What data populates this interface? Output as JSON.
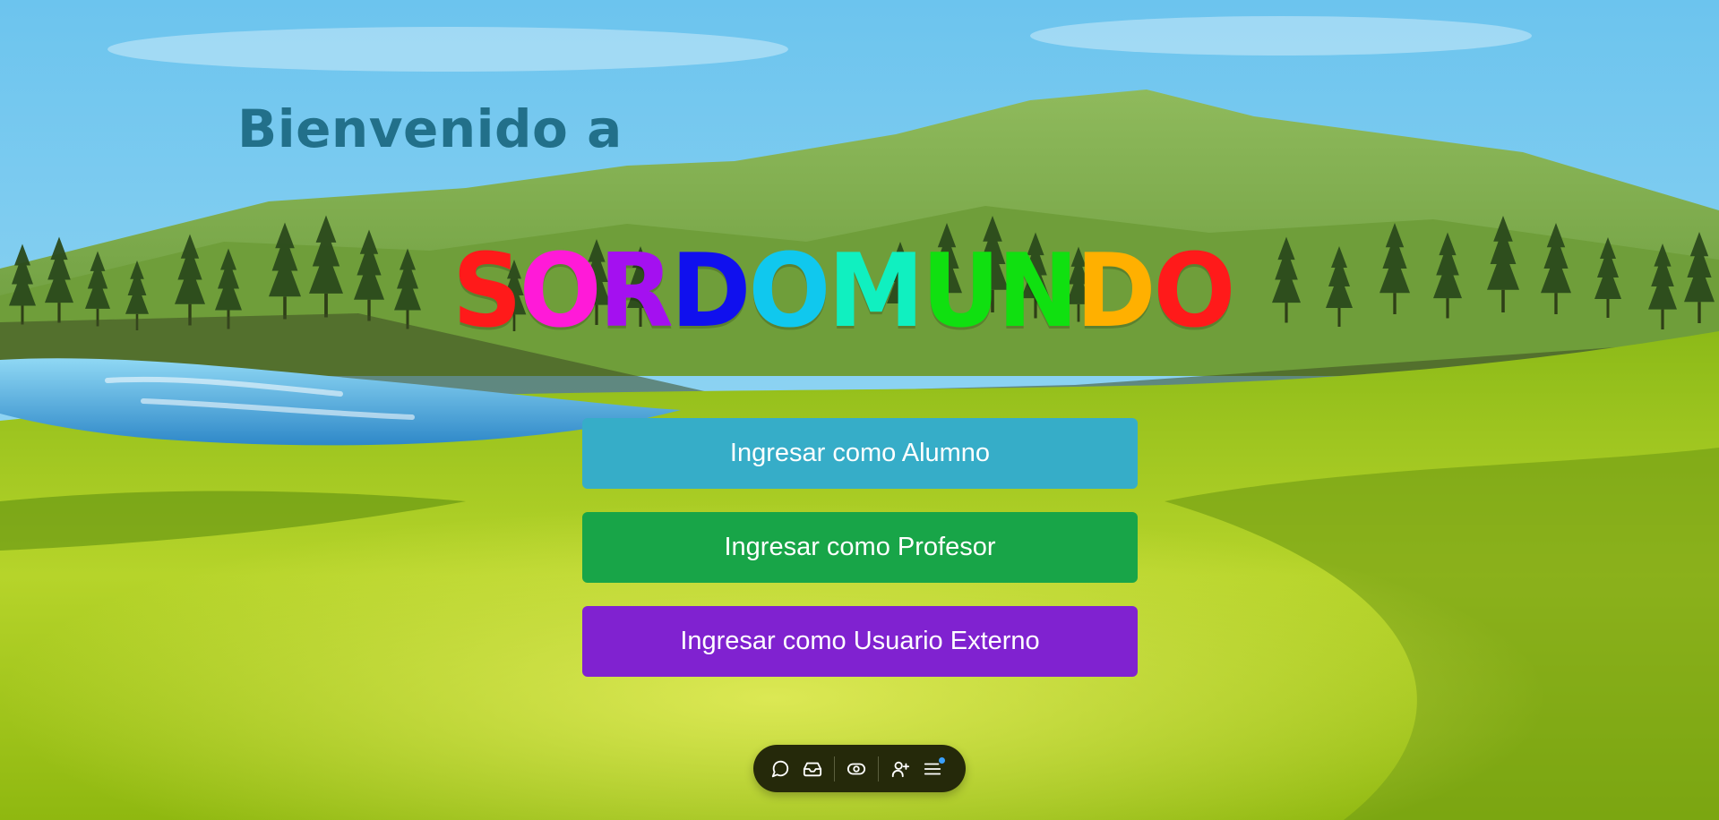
{
  "header": {
    "welcome": "Bienvenido a"
  },
  "logo": {
    "letters": [
      {
        "char": "S",
        "color": "#ff1a1a"
      },
      {
        "char": "O",
        "color": "#ff1ad8"
      },
      {
        "char": "R",
        "color": "#a410f0"
      },
      {
        "char": "D",
        "color": "#1010ee"
      },
      {
        "char": "O",
        "color": "#10c8ee"
      },
      {
        "char": "M",
        "color": "#10f0c0"
      },
      {
        "char": "U",
        "color": "#10e010"
      },
      {
        "char": "N",
        "color": "#10e010"
      },
      {
        "char": "D",
        "color": "#ffb000"
      },
      {
        "char": "O",
        "color": "#ff1a1a"
      }
    ]
  },
  "buttons": {
    "alumno": {
      "label": "Ingresar como Alumno",
      "color": "#36adc8"
    },
    "profesor": {
      "label": "Ingresar como Profesor",
      "color": "#18a548"
    },
    "externo": {
      "label": "Ingresar como Usuario Externo",
      "color": "#8022d0"
    }
  },
  "toolbar": {
    "icons": [
      "chat-icon",
      "inbox-icon",
      "eye-icon",
      "add-user-icon",
      "menu-icon"
    ]
  }
}
